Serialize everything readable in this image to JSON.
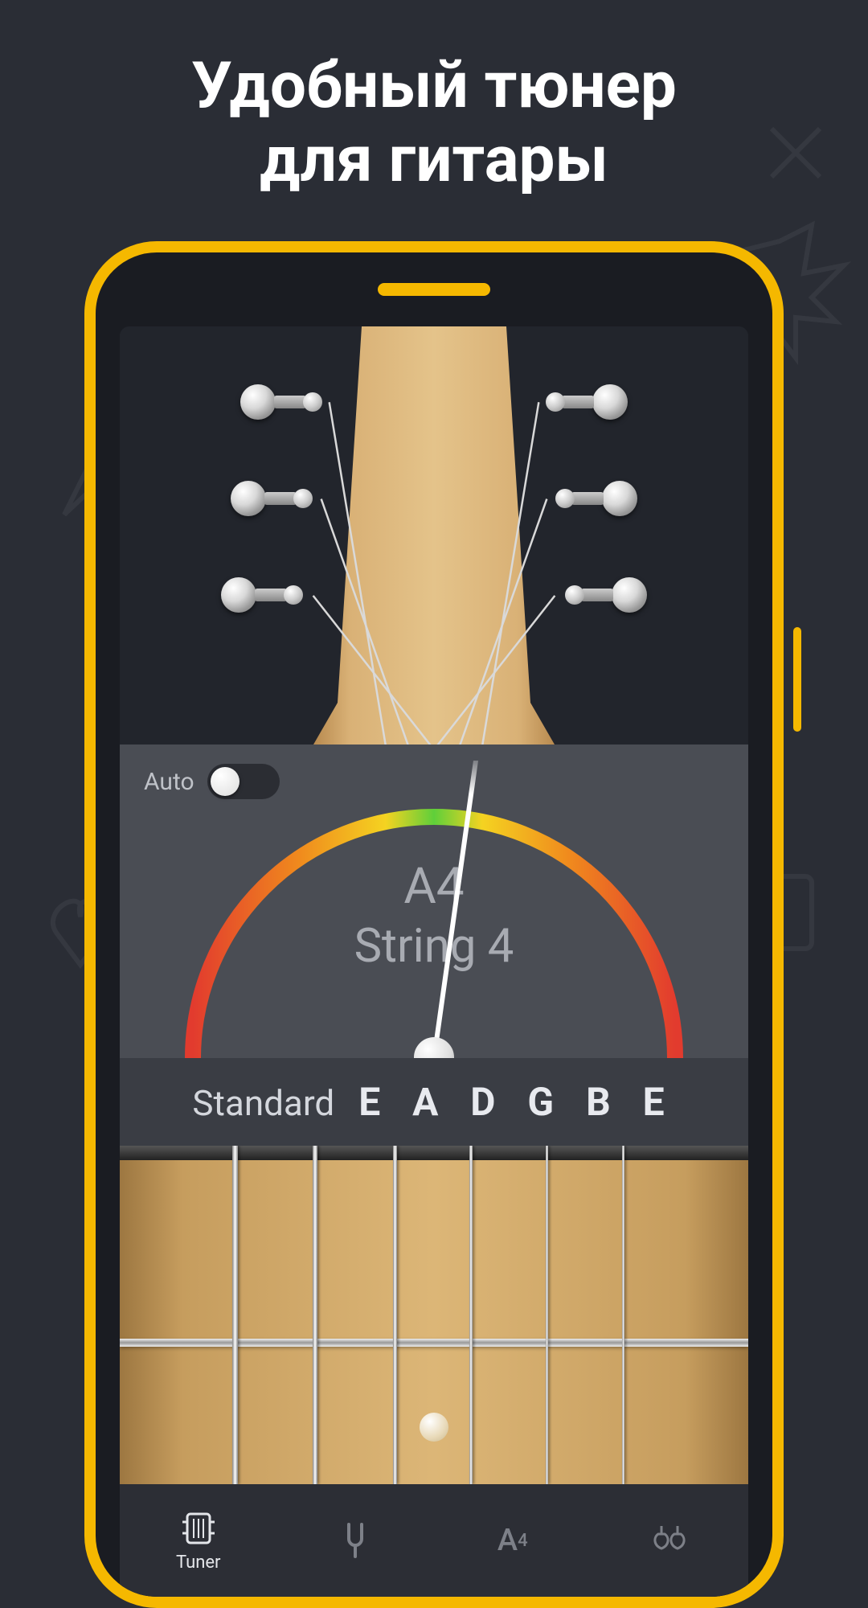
{
  "header": {
    "title_l1": "Удобный тюнер",
    "title_l2": "для гитары"
  },
  "colors": {
    "accent": "#f5b800",
    "panel": "#4a4d54",
    "bg": "#2a2d35"
  },
  "tuner": {
    "auto_label": "Auto",
    "auto_on": false,
    "note": "A4",
    "string_label": "String 4",
    "needle_angle_deg": 8,
    "tuning_name": "Standard",
    "tuning_notes": "E A D G B E"
  },
  "nav": {
    "items": [
      {
        "id": "tuner",
        "label": "Tuner",
        "active": true
      },
      {
        "id": "fork",
        "label": "",
        "active": false
      },
      {
        "id": "pitch",
        "label": "",
        "active": false,
        "pitch_text": "A₄"
      },
      {
        "id": "instruments",
        "label": "",
        "active": false
      }
    ]
  }
}
